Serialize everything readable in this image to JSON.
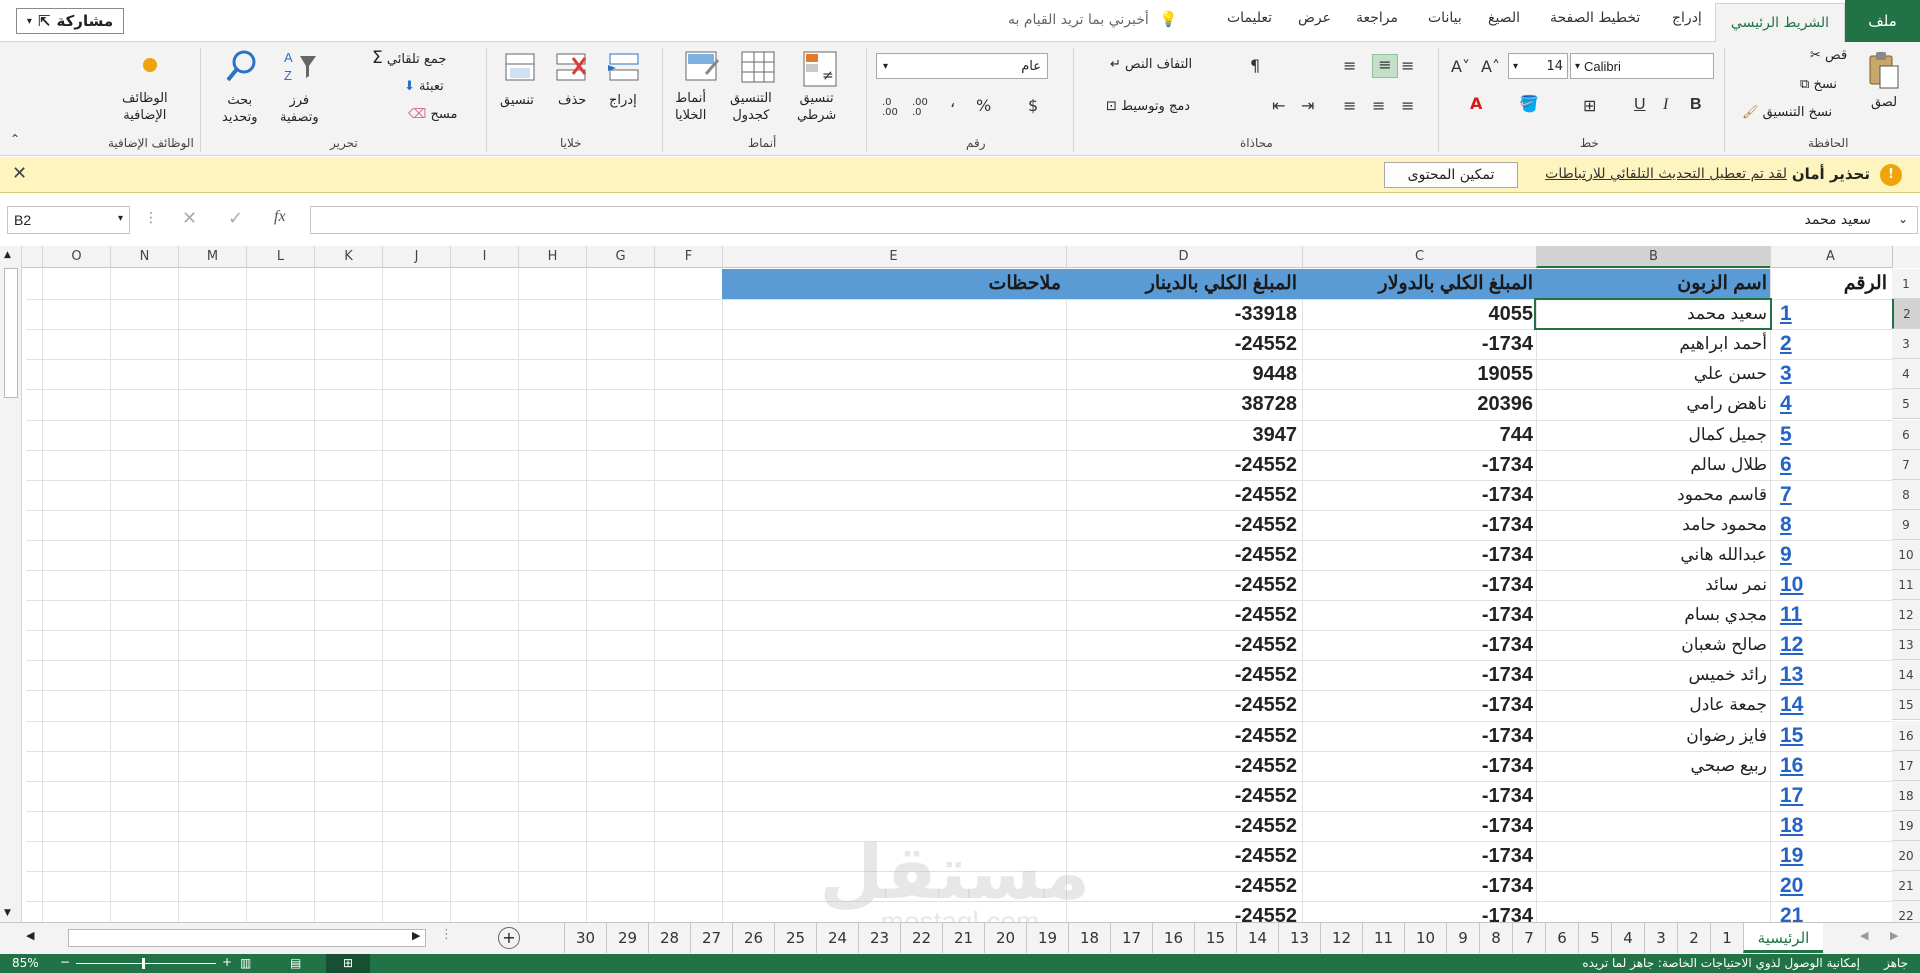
{
  "colors": {
    "accent": "#217346",
    "header_fill": "#5b9bd5",
    "link_blue": "#2563c7",
    "security_bg": "#fdf4bf",
    "warning_icon": "#f0a30a"
  },
  "tabs": {
    "file": "ملف",
    "home": "الشريط الرئيسي",
    "insert": "إدراج",
    "page_layout": "تخطيط الصفحة",
    "formulas": "الصيغ",
    "data": "بيانات",
    "review": "مراجعة",
    "view": "عرض",
    "help": "تعليمات",
    "tell_me": "أخبرني بما تريد القيام به",
    "share": "مشاركة"
  },
  "ribbon": {
    "clipboard": {
      "label": "الحافظة",
      "paste": "لصق",
      "cut": "قص",
      "copy": "نسخ",
      "format_painter": "نسخ التنسيق"
    },
    "font": {
      "label": "خط",
      "name": "Calibri",
      "size": "14",
      "bold": "B",
      "italic": "I",
      "underline": "U"
    },
    "alignment": {
      "label": "محاذاة",
      "wrap": "التفاف النص",
      "merge": "دمج وتوسيط"
    },
    "number": {
      "label": "رقم",
      "format": "عام",
      "currency": "$",
      "percent": "%",
      "comma": "،",
      "inc_dec": ".00\n.0",
      "dec_dec": ".0\n.00"
    },
    "styles": {
      "label": "أنماط",
      "conditional": "تنسيق\nشرطي",
      "as_table": "التنسيق\nكجدول",
      "cell_styles": "أنماط\nالخلايا"
    },
    "cells": {
      "label": "خلايا",
      "insert": "إدراج",
      "delete": "حذف",
      "format": "تنسيق"
    },
    "editing": {
      "label": "تحرير",
      "autosum": "جمع تلقائي",
      "fill": "تعبئة",
      "clear": "مسح",
      "sort": "فرز\nوتصفية",
      "find": "بحث\nوتحديد"
    },
    "addins": {
      "label": "الوظائف الإضافية",
      "addins": "الوظائف\nالإضافية"
    }
  },
  "security": {
    "title": "تحذير أمان",
    "message": "لقد تم تعطيل التحديث التلقائي للارتباطات",
    "button": "تمكين المحتوى"
  },
  "formula": {
    "cell_ref": "B2",
    "content": "سعيد محمد",
    "fx": "fx"
  },
  "columns_rtl": [
    "A",
    "B",
    "C",
    "D",
    "E",
    "F",
    "G",
    "H",
    "I",
    "J",
    "K",
    "L",
    "M",
    "N",
    "O"
  ],
  "table": {
    "headers": {
      "num": "الرقم",
      "name": "اسم الزبون",
      "usd": "المبلغ الكلي بالدولار",
      "dinar": "المبلغ الكلي بالدينار",
      "notes": "ملاحظات"
    },
    "rows": [
      {
        "row": "2",
        "num": "1",
        "name": "سعيد محمد",
        "usd": "4055",
        "dinar": "-33918"
      },
      {
        "row": "3",
        "num": "2",
        "name": "أحمد ابراهيم",
        "usd": "-1734",
        "dinar": "-24552"
      },
      {
        "row": "4",
        "num": "3",
        "name": "حسن علي",
        "usd": "19055",
        "dinar": "9448"
      },
      {
        "row": "5",
        "num": "4",
        "name": "ناهض رامي",
        "usd": "20396",
        "dinar": "38728"
      },
      {
        "row": "6",
        "num": "5",
        "name": "جميل كمال",
        "usd": "744",
        "dinar": "3947"
      },
      {
        "row": "7",
        "num": "6",
        "name": "طلال سالم",
        "usd": "-1734",
        "dinar": "-24552"
      },
      {
        "row": "8",
        "num": "7",
        "name": "قاسم محمود",
        "usd": "-1734",
        "dinar": "-24552"
      },
      {
        "row": "9",
        "num": "8",
        "name": "محمود حامد",
        "usd": "-1734",
        "dinar": "-24552"
      },
      {
        "row": "10",
        "num": "9",
        "name": "عبدالله هاني",
        "usd": "-1734",
        "dinar": "-24552"
      },
      {
        "row": "11",
        "num": "10",
        "name": "نمر سائد",
        "usd": "-1734",
        "dinar": "-24552"
      },
      {
        "row": "12",
        "num": "11",
        "name": "مجدي بسام",
        "usd": "-1734",
        "dinar": "-24552"
      },
      {
        "row": "13",
        "num": "12",
        "name": "صالح شعبان",
        "usd": "-1734",
        "dinar": "-24552"
      },
      {
        "row": "14",
        "num": "13",
        "name": "رائد خميس",
        "usd": "-1734",
        "dinar": "-24552"
      },
      {
        "row": "15",
        "num": "14",
        "name": "جمعة عادل",
        "usd": "-1734",
        "dinar": "-24552"
      },
      {
        "row": "16",
        "num": "15",
        "name": "فايز رضوان",
        "usd": "-1734",
        "dinar": "-24552"
      },
      {
        "row": "17",
        "num": "16",
        "name": "ربيع صبحي",
        "usd": "-1734",
        "dinar": "-24552"
      },
      {
        "row": "18",
        "num": "17",
        "name": "",
        "usd": "-1734",
        "dinar": "-24552"
      },
      {
        "row": "19",
        "num": "18",
        "name": "",
        "usd": "-1734",
        "dinar": "-24552"
      },
      {
        "row": "20",
        "num": "19",
        "name": "",
        "usd": "-1734",
        "dinar": "-24552"
      },
      {
        "row": "21",
        "num": "20",
        "name": "",
        "usd": "-1734",
        "dinar": "-24552"
      },
      {
        "row": "22",
        "num": "21",
        "name": "",
        "usd": "-1734",
        "dinar": "-24552"
      }
    ]
  },
  "sheets": {
    "active": "الرئيسية",
    "tabs": [
      "1",
      "2",
      "3",
      "4",
      "5",
      "6",
      "7",
      "8",
      "9",
      "10",
      "11",
      "12",
      "13",
      "14",
      "15",
      "16",
      "17",
      "18",
      "19",
      "20",
      "21",
      "22",
      "23",
      "24",
      "25",
      "26",
      "27",
      "28",
      "29",
      "30"
    ]
  },
  "status": {
    "ready": "جاهز",
    "accessibility": "إمكانية الوصول لذوي الاحتياجات الخاصة: جاهز لما تريده",
    "zoom": "85%"
  },
  "watermark": {
    "arabic": "مستقل",
    "latin": "mostaql.com"
  }
}
